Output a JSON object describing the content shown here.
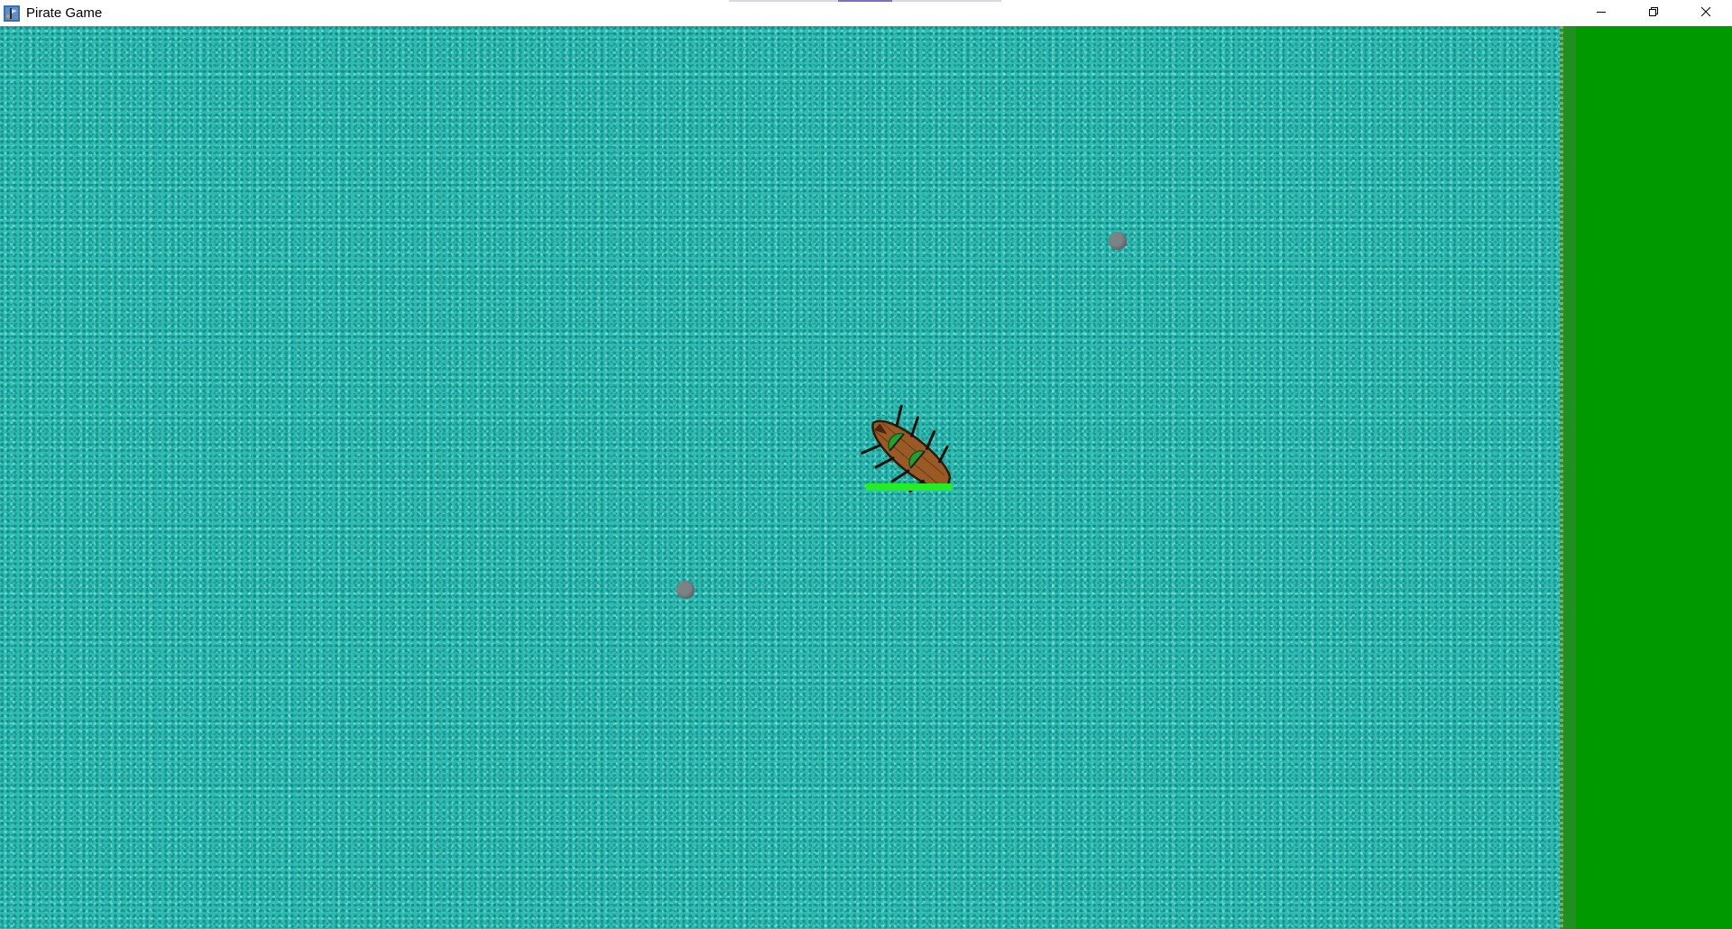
{
  "window": {
    "title": "Pirate Game",
    "app_icon": "pirate-flag-icon",
    "controls": {
      "minimize_icon": "minimize-icon",
      "restore_icon": "restore-icon",
      "close_icon": "close-icon"
    }
  },
  "colors": {
    "sea": "#2bbcb4",
    "land": "#009900",
    "cannonball": "#7d8285",
    "ship_hull": "#9a5a25",
    "ship_sail": "#22a032",
    "health_bar": "#22ee22"
  },
  "game": {
    "player_ship": {
      "icon": "pirate-ship-icon",
      "health_fraction": 1.0
    },
    "cannonballs_visible": 2
  }
}
